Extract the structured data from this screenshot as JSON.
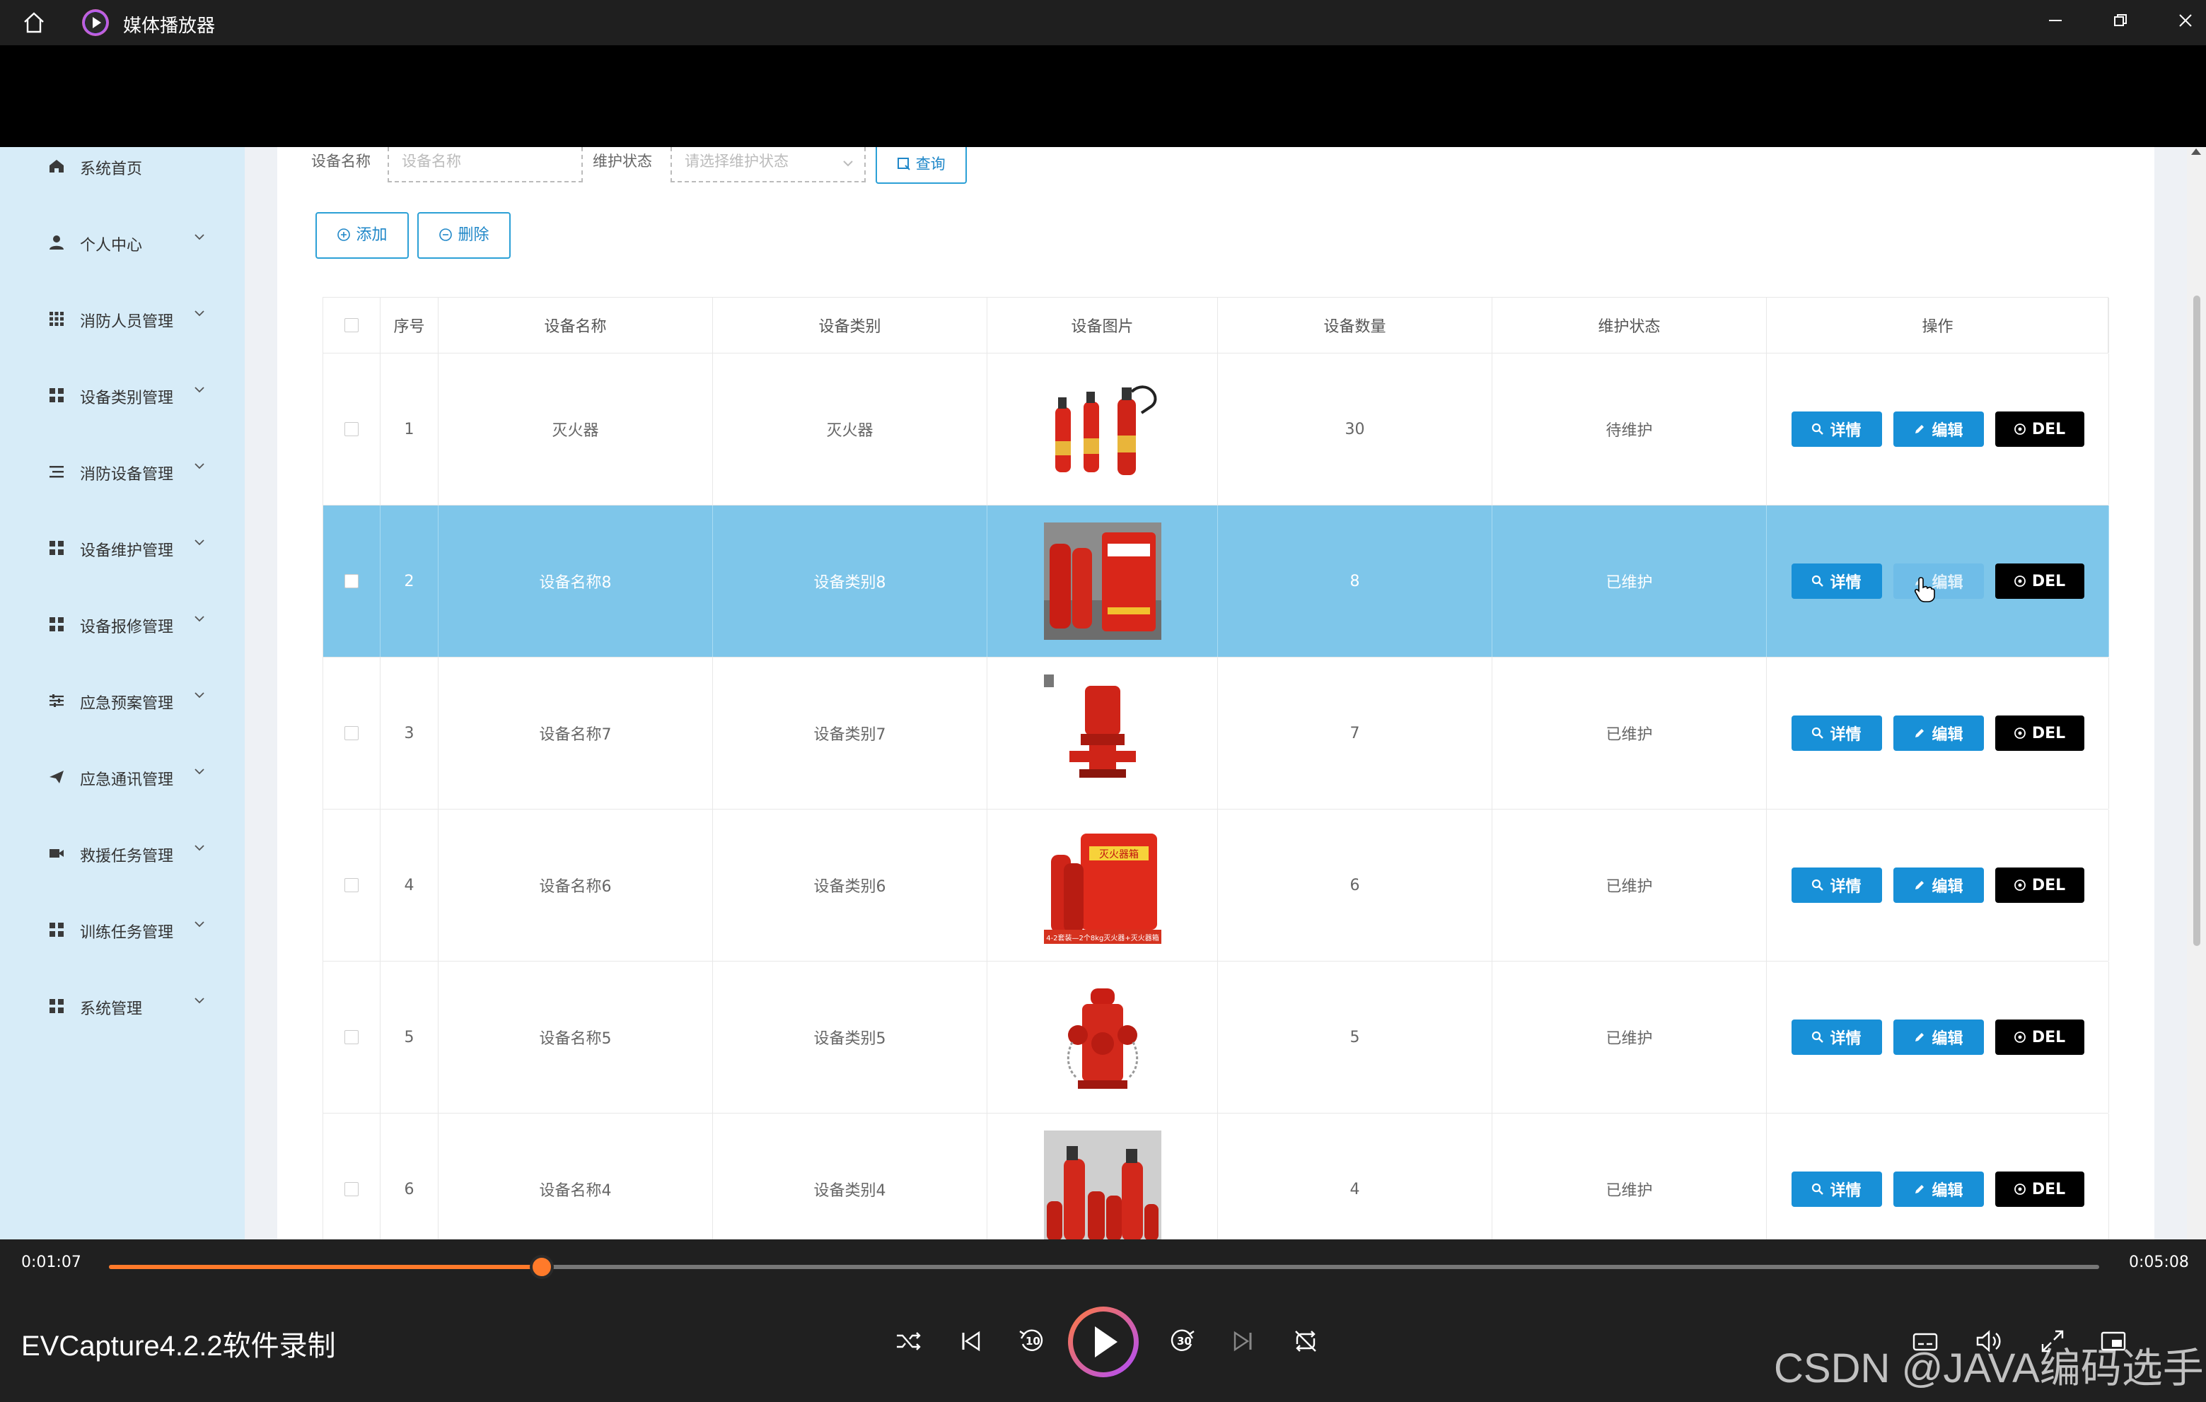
{
  "window": {
    "title": "媒体播放器"
  },
  "sidebar": {
    "items": [
      {
        "label": "系统首页",
        "icon": "home-icon",
        "has_chevron": false
      },
      {
        "label": "个人中心",
        "icon": "user-icon",
        "has_chevron": true
      },
      {
        "label": "消防人员管理",
        "icon": "grid9-icon",
        "has_chevron": true
      },
      {
        "label": "设备类别管理",
        "icon": "grid4-icon",
        "has_chevron": true
      },
      {
        "label": "消防设备管理",
        "icon": "list-icon",
        "has_chevron": true
      },
      {
        "label": "设备维护管理",
        "icon": "grid4-icon",
        "has_chevron": true
      },
      {
        "label": "设备报修管理",
        "icon": "grid4-icon",
        "has_chevron": true
      },
      {
        "label": "应急预案管理",
        "icon": "sliders-icon",
        "has_chevron": true
      },
      {
        "label": "应急通讯管理",
        "icon": "send-icon",
        "has_chevron": true
      },
      {
        "label": "救援任务管理",
        "icon": "video-icon",
        "has_chevron": true
      },
      {
        "label": "训练任务管理",
        "icon": "grid4-icon",
        "has_chevron": true
      },
      {
        "label": "系统管理",
        "icon": "grid4-icon",
        "has_chevron": true
      }
    ]
  },
  "search": {
    "name_label": "设备名称",
    "name_placeholder": "设备名称",
    "status_label": "维护状态",
    "status_placeholder": "请选择维护状态",
    "query_label": "查询"
  },
  "actions": {
    "add_label": "添加",
    "delete_label": "删除"
  },
  "table": {
    "columns": [
      "序号",
      "设备名称",
      "设备类别",
      "设备图片",
      "设备数量",
      "维护状态",
      "操作"
    ],
    "rows": [
      {
        "index": "1",
        "name": "灭火器",
        "category": "灭火器",
        "image": "co2-extinguishers",
        "qty": "30",
        "status": "待维护",
        "selected": false
      },
      {
        "index": "2",
        "name": "设备名称8",
        "category": "设备类别8",
        "image": "extinguisher-cabinet",
        "qty": "8",
        "status": "已维护",
        "selected": true
      },
      {
        "index": "3",
        "name": "设备名称7",
        "category": "设备类别7",
        "image": "fire-pump",
        "qty": "7",
        "status": "已维护",
        "selected": false
      },
      {
        "index": "4",
        "name": "设备名称6",
        "category": "设备类别6",
        "image": "extinguisher-box",
        "qty": "6",
        "status": "已维护",
        "selected": false
      },
      {
        "index": "5",
        "name": "设备名称5",
        "category": "设备类别5",
        "image": "fire-hydrant",
        "qty": "5",
        "status": "已维护",
        "selected": false
      },
      {
        "index": "6",
        "name": "设备名称4",
        "category": "设备类别4",
        "image": "extinguisher-group",
        "qty": "4",
        "status": "已维护",
        "selected": false
      }
    ],
    "op_labels": {
      "detail": "详情",
      "edit": "编辑",
      "del": "DEL"
    },
    "image_banner_text": "4-2套装—2个8kg灭火器+灭火器箱",
    "image_box_text": "灭火器箱"
  },
  "player": {
    "current_time": "0:01:07",
    "total_time": "0:05:08",
    "progress": 0.2175,
    "caption": "EVCapture4.2.2软件录制",
    "skip_back": "10",
    "skip_fwd": "30",
    "watermark": "CSDN @JAVA编码选手",
    "accent": "#ff7a2a"
  }
}
